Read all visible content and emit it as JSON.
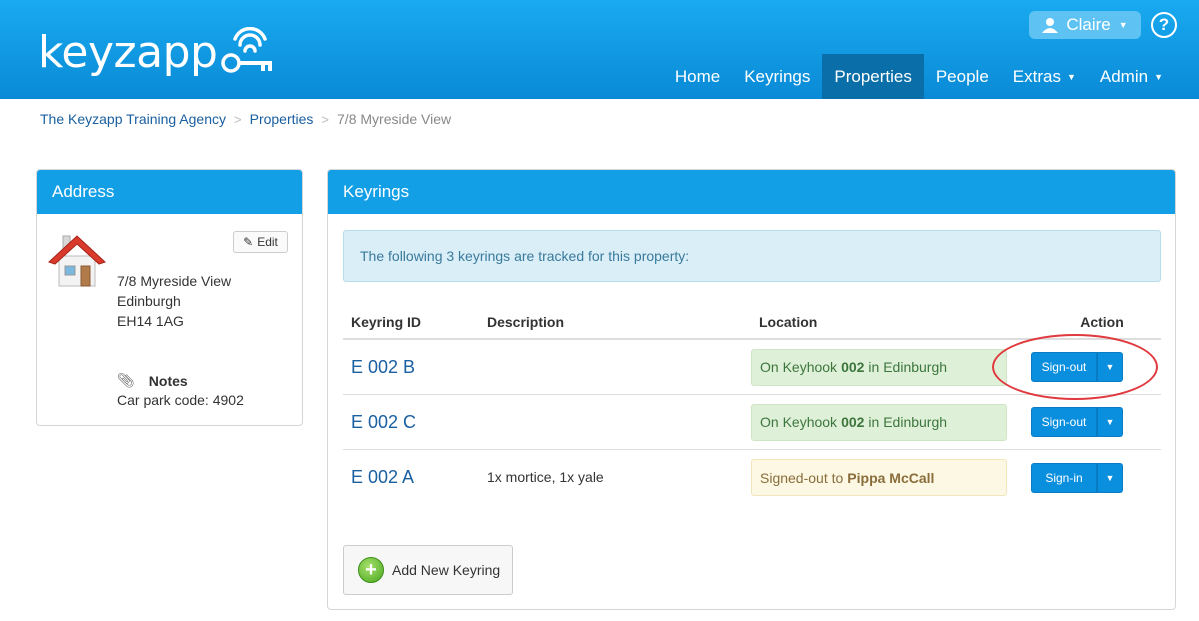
{
  "header": {
    "logo_text": "keyzapp",
    "user_name": "Claire",
    "help_label": "?",
    "nav": [
      {
        "label": "Home"
      },
      {
        "label": "Keyrings"
      },
      {
        "label": "Properties"
      },
      {
        "label": "People"
      },
      {
        "label": "Extras"
      },
      {
        "label": "Admin"
      }
    ]
  },
  "breadcrumb": {
    "agency": "The Keyzapp Training Agency",
    "section": "Properties",
    "current": "7/8 Myreside View",
    "separator": ">"
  },
  "address_panel": {
    "title": "Address",
    "edit_label": "Edit",
    "lines": [
      "7/8 Myreside View",
      "Edinburgh",
      "EH14 1AG"
    ],
    "notes_title": "Notes",
    "notes_text": "Car park code: 4902"
  },
  "keyrings_panel": {
    "title": "Keyrings",
    "info": "The following 3 keyrings are tracked for this property:",
    "columns": [
      "Keyring ID",
      "Description",
      "Location",
      "Action"
    ],
    "rows": [
      {
        "id": "E 002 B",
        "description": "",
        "loc_prefix": "On Keyhook",
        "loc_bold": "002",
        "loc_suffix": "in Edinburgh",
        "status": "green",
        "action": "Sign-out"
      },
      {
        "id": "E 002 C",
        "description": "",
        "loc_prefix": "On Keyhook",
        "loc_bold": "002",
        "loc_suffix": "in Edinburgh",
        "status": "green",
        "action": "Sign-out"
      },
      {
        "id": "E 002 A",
        "description": "1x mortice, 1x yale",
        "loc_prefix": "Signed-out to",
        "loc_bold": "Pippa McCall",
        "loc_suffix": "",
        "status": "yellow",
        "action": "Sign-in"
      }
    ],
    "add_label": "Add New Keyring"
  },
  "colors": {
    "header_blue": "#139fe6",
    "active_nav": "#0a6fa8",
    "highlight_red": "#e0393e"
  }
}
